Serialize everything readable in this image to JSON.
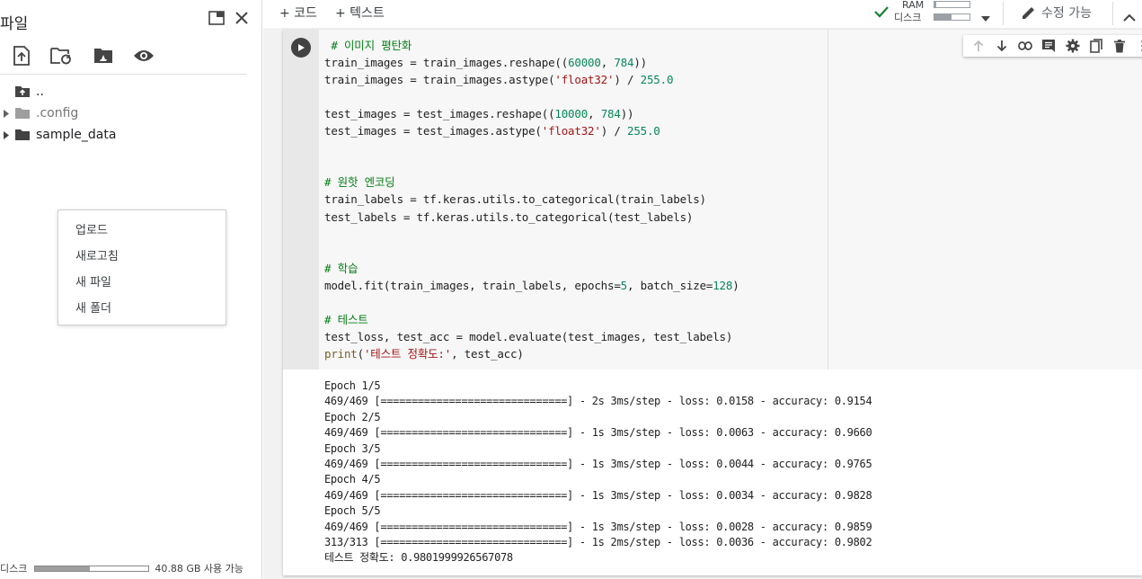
{
  "sidebar": {
    "title": "파일",
    "tree": [
      {
        "label": ".."
      },
      {
        "label": ".config"
      },
      {
        "label": "sample_data"
      }
    ],
    "context_menu": [
      "업로드",
      "새로고침",
      "새 파일",
      "새 폴더"
    ],
    "disk": {
      "label": "디스크",
      "usage_fraction": 0.48,
      "available": "40.88 GB 사용 가능"
    }
  },
  "toolbar": {
    "add_code": "+ 코드",
    "add_text": "+ 텍스트",
    "ram_label": "RAM",
    "disk_label": "디스크",
    "ram_fraction": 0.05,
    "disk_fraction": 0.48,
    "edit_label": "수정 가능"
  },
  "code": {
    "lines": [
      {
        "parts": [
          {
            "t": " # 이미지 평탄화",
            "c": "cmt"
          }
        ]
      },
      {
        "parts": [
          {
            "t": "train_images = train_images.reshape(("
          },
          {
            "t": "60000",
            "c": "num"
          },
          {
            "t": ", "
          },
          {
            "t": "784",
            "c": "num"
          },
          {
            "t": "))"
          }
        ]
      },
      {
        "parts": [
          {
            "t": "train_images = train_images.astype("
          },
          {
            "t": "'float32'",
            "c": "str"
          },
          {
            "t": ") / "
          },
          {
            "t": "255.0",
            "c": "num"
          }
        ]
      },
      {
        "parts": []
      },
      {
        "parts": [
          {
            "t": "test_images = test_images.reshape(("
          },
          {
            "t": "10000",
            "c": "num"
          },
          {
            "t": ", "
          },
          {
            "t": "784",
            "c": "num"
          },
          {
            "t": "))"
          }
        ]
      },
      {
        "parts": [
          {
            "t": "test_images = test_images.astype("
          },
          {
            "t": "'float32'",
            "c": "str"
          },
          {
            "t": ") / "
          },
          {
            "t": "255.0",
            "c": "num"
          }
        ]
      },
      {
        "parts": []
      },
      {
        "parts": []
      },
      {
        "parts": [
          {
            "t": "# 원핫 엔코딩",
            "c": "cmt"
          }
        ]
      },
      {
        "parts": [
          {
            "t": "train_labels = tf.keras.utils.to_categorical(train_labels)"
          }
        ]
      },
      {
        "parts": [
          {
            "t": "test_labels = tf.keras.utils.to_categorical(test_labels)"
          }
        ]
      },
      {
        "parts": []
      },
      {
        "parts": []
      },
      {
        "parts": [
          {
            "t": "# 학습",
            "c": "cmt"
          }
        ]
      },
      {
        "parts": [
          {
            "t": "model.fit(train_images, train_labels, epochs="
          },
          {
            "t": "5",
            "c": "num"
          },
          {
            "t": ", batch_size="
          },
          {
            "t": "128",
            "c": "num"
          },
          {
            "t": ")"
          }
        ]
      },
      {
        "parts": []
      },
      {
        "parts": [
          {
            "t": "# 테스트",
            "c": "cmt"
          }
        ]
      },
      {
        "parts": [
          {
            "t": "test_loss, test_acc = model.evaluate(test_images, test_labels)"
          }
        ]
      },
      {
        "parts": [
          {
            "t": "print",
            "c": "kw"
          },
          {
            "t": "("
          },
          {
            "t": "'테스트 정확도:'",
            "c": "str"
          },
          {
            "t": ", test_acc)"
          }
        ]
      }
    ]
  },
  "output": {
    "lines": [
      "Epoch 1/5",
      "469/469 [==============================] - 2s 3ms/step - loss: 0.0158 - accuracy: 0.9154",
      "Epoch 2/5",
      "469/469 [==============================] - 1s 3ms/step - loss: 0.0063 - accuracy: 0.9660",
      "Epoch 3/5",
      "469/469 [==============================] - 1s 3ms/step - loss: 0.0044 - accuracy: 0.9765",
      "Epoch 4/5",
      "469/469 [==============================] - 1s 3ms/step - loss: 0.0034 - accuracy: 0.9828",
      "Epoch 5/5",
      "469/469 [==============================] - 1s 3ms/step - loss: 0.0028 - accuracy: 0.9859",
      "313/313 [==============================] - 1s 2ms/step - loss: 0.0036 - accuracy: 0.9802",
      "테스트 정확도: 0.9801999926567078"
    ]
  },
  "colors": {
    "accent_green": "#188038",
    "comment": "#067d17",
    "number": "#098658",
    "string": "#a31515"
  },
  "icons": {
    "file_toolbar": [
      "upload-icon",
      "refresh-folder-icon",
      "mount-drive-icon",
      "eye-icon"
    ],
    "cell_toolbar": [
      "move-up-icon",
      "move-down-icon",
      "link-icon",
      "comment-icon",
      "settings-icon",
      "mirror-cell-icon",
      "delete-icon",
      "more-icon"
    ]
  }
}
